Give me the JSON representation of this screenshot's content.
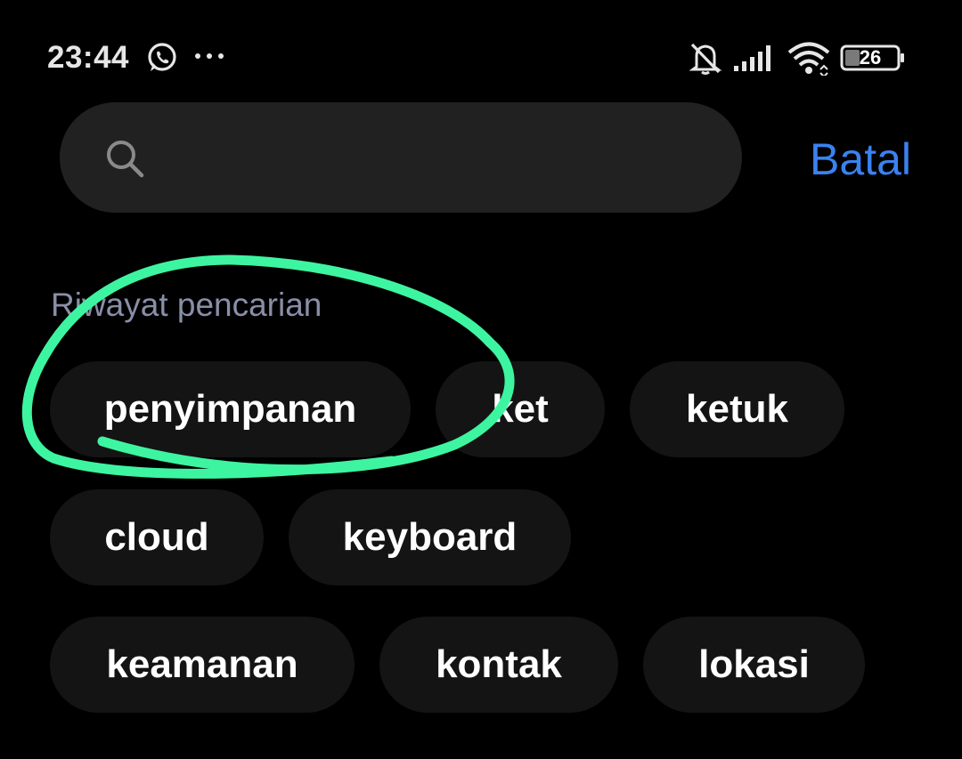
{
  "status_bar": {
    "time": "23:44",
    "battery_level": "26",
    "icons": [
      "whatsapp-icon",
      "more-dots-icon",
      "bell-mute-icon",
      "signal-icon",
      "wifi-icon",
      "battery-icon"
    ]
  },
  "search": {
    "placeholder": "",
    "value": "",
    "icon": "search-icon",
    "cancel_label": "Batal"
  },
  "history": {
    "title": "Riwayat pencarian",
    "chips": [
      "penyimpanan",
      "ket",
      "ketuk",
      "cloud",
      "keyboard",
      "keamanan",
      "kontak",
      "lokasi"
    ]
  },
  "colors": {
    "background": "#000000",
    "search_box": "#212121",
    "chip": "#141414",
    "accent": "#3a82f0",
    "section_title": "#8a8fa8",
    "annotation": "#3df5a0"
  }
}
